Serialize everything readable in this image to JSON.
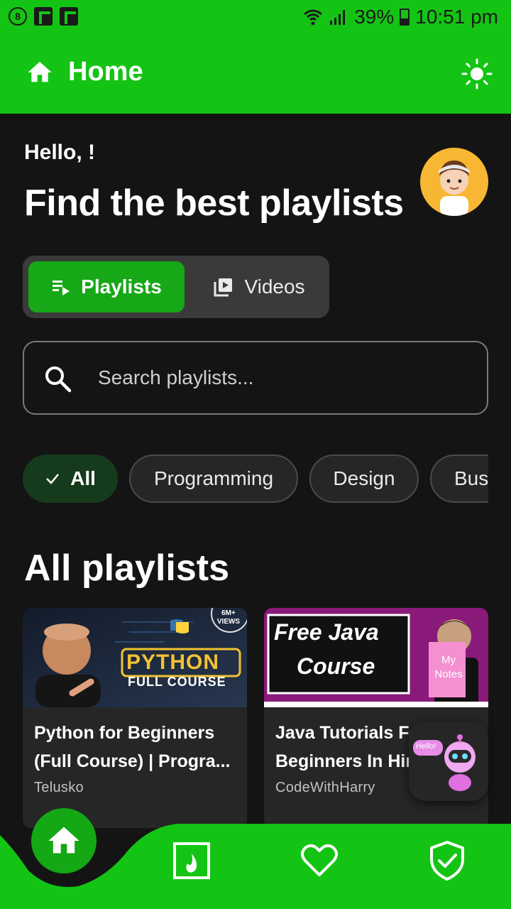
{
  "status_bar": {
    "left_badge": "8",
    "battery": "39%",
    "time": "10:51 pm"
  },
  "app_bar": {
    "title": "Home",
    "icons": {
      "home": "home-icon",
      "theme": "sun-icon"
    }
  },
  "header": {
    "greeting": "Hello, !",
    "headline": "Find the best playlists"
  },
  "toggle": {
    "active_label": "Playlists",
    "inactive_label": "Videos"
  },
  "search": {
    "placeholder": "Search playlists..."
  },
  "chips": {
    "items": [
      "All",
      "Programming",
      "Design",
      "Bus"
    ]
  },
  "section": {
    "title": "All playlists"
  },
  "cards": [
    {
      "title": "Python for Beginners (Full Course) | Progra...",
      "channel": "Telusko",
      "thumb_badge": "6M+ VIEWS",
      "thumb_main": "PYTHON",
      "thumb_sub": "FULL COURSE"
    },
    {
      "title": "Java Tutorials For Beginners In Hindi",
      "channel": "CodeWithHarry",
      "thumb_line1": "Free Java",
      "thumb_line2": "Course",
      "thumb_notes": "My Notes"
    }
  ],
  "bot": {
    "bubble": "Hello!"
  },
  "colors": {
    "brand_green": "#14c414",
    "active_green": "#16a816",
    "background": "#141414",
    "surface": "#262626"
  }
}
